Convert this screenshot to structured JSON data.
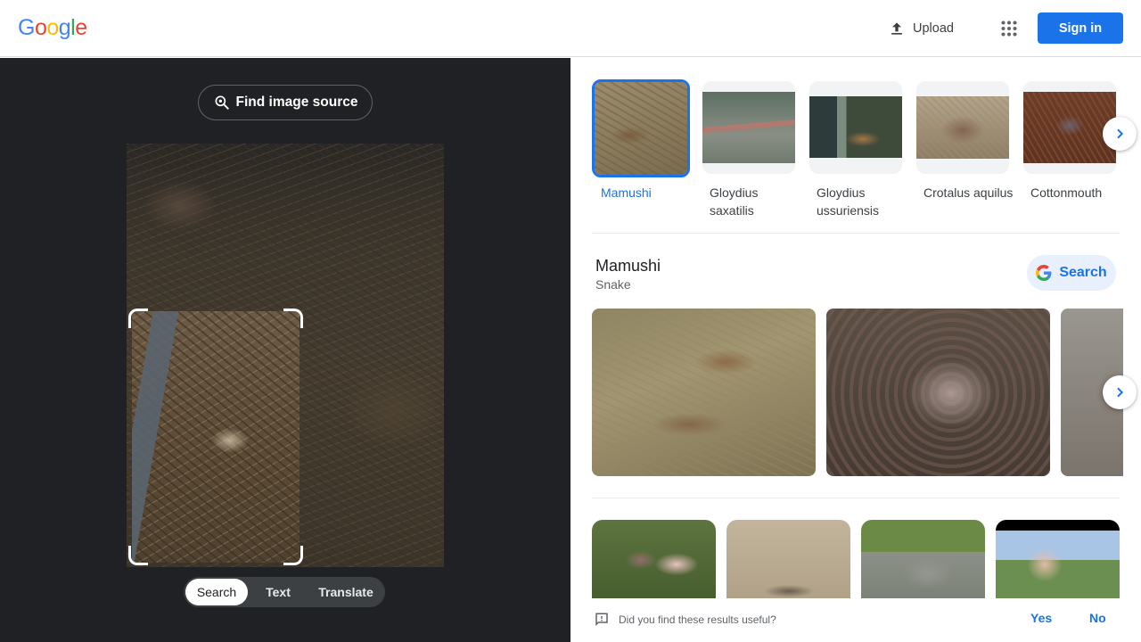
{
  "header": {
    "logo": [
      "G",
      "o",
      "o",
      "g",
      "l",
      "e"
    ],
    "logo_colors": [
      "#4285F4",
      "#EA4335",
      "#FBBC05",
      "#4285F4",
      "#34A853",
      "#EA4335"
    ],
    "upload_label": "Upload",
    "signin_label": "Sign in"
  },
  "left": {
    "find_source_label": "Find image source",
    "tabs": [
      {
        "label": "Search",
        "active": true
      },
      {
        "label": "Text",
        "active": false
      },
      {
        "label": "Translate",
        "active": false
      }
    ]
  },
  "related": [
    {
      "label": "Mamushi",
      "active": true
    },
    {
      "label": "Gloydius saxatilis",
      "active": false
    },
    {
      "label": "Gloydius ussuriensis",
      "active": false
    },
    {
      "label": "Crotalus aquilus",
      "active": false
    },
    {
      "label": "Cottonmouth",
      "active": false
    }
  ],
  "entity": {
    "title": "Mamushi",
    "subtitle": "Snake",
    "search_label": "Search"
  },
  "feedback": {
    "question": "Did you find these results useful?",
    "yes": "Yes",
    "no": "No"
  },
  "colors": {
    "accent": "#1a73e8",
    "left_bg": "#202124"
  }
}
